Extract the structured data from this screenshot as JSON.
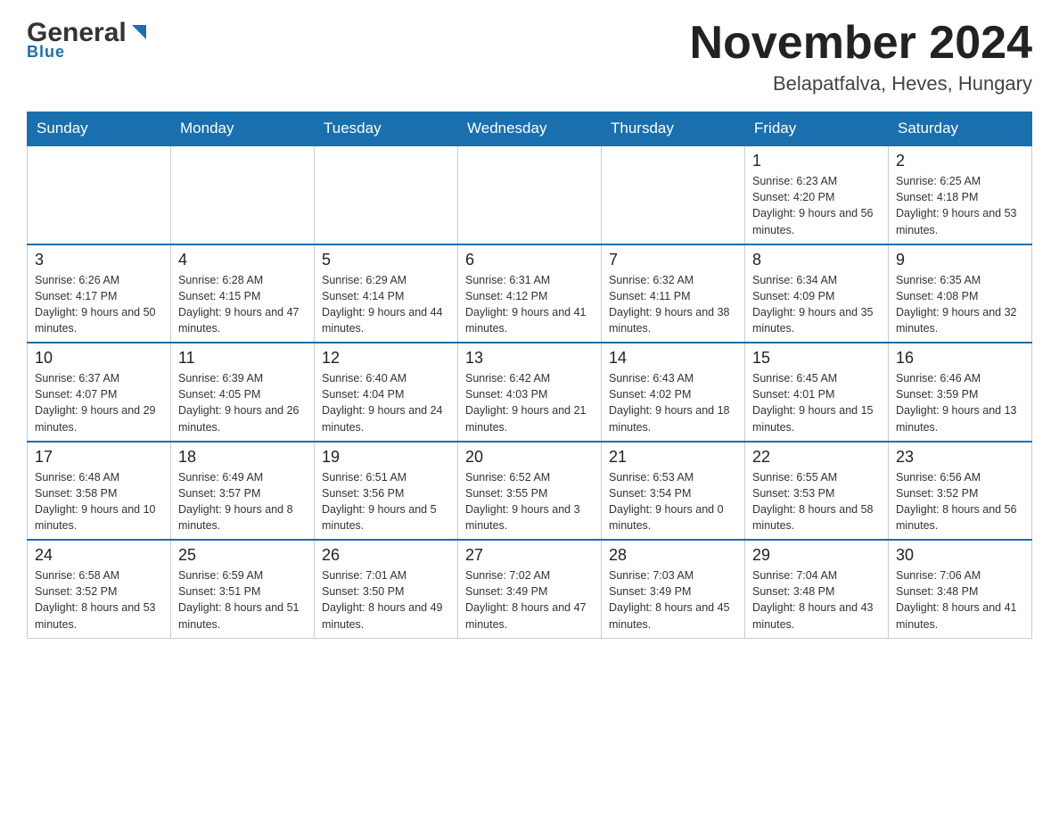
{
  "header": {
    "logo_general": "General",
    "logo_blue": "Blue",
    "month_title": "November 2024",
    "location": "Belapatfalva, Heves, Hungary"
  },
  "days_of_week": [
    "Sunday",
    "Monday",
    "Tuesday",
    "Wednesday",
    "Thursday",
    "Friday",
    "Saturday"
  ],
  "weeks": [
    {
      "days": [
        {
          "num": "",
          "info": ""
        },
        {
          "num": "",
          "info": ""
        },
        {
          "num": "",
          "info": ""
        },
        {
          "num": "",
          "info": ""
        },
        {
          "num": "",
          "info": ""
        },
        {
          "num": "1",
          "info": "Sunrise: 6:23 AM\nSunset: 4:20 PM\nDaylight: 9 hours and 56 minutes."
        },
        {
          "num": "2",
          "info": "Sunrise: 6:25 AM\nSunset: 4:18 PM\nDaylight: 9 hours and 53 minutes."
        }
      ]
    },
    {
      "days": [
        {
          "num": "3",
          "info": "Sunrise: 6:26 AM\nSunset: 4:17 PM\nDaylight: 9 hours and 50 minutes."
        },
        {
          "num": "4",
          "info": "Sunrise: 6:28 AM\nSunset: 4:15 PM\nDaylight: 9 hours and 47 minutes."
        },
        {
          "num": "5",
          "info": "Sunrise: 6:29 AM\nSunset: 4:14 PM\nDaylight: 9 hours and 44 minutes."
        },
        {
          "num": "6",
          "info": "Sunrise: 6:31 AM\nSunset: 4:12 PM\nDaylight: 9 hours and 41 minutes."
        },
        {
          "num": "7",
          "info": "Sunrise: 6:32 AM\nSunset: 4:11 PM\nDaylight: 9 hours and 38 minutes."
        },
        {
          "num": "8",
          "info": "Sunrise: 6:34 AM\nSunset: 4:09 PM\nDaylight: 9 hours and 35 minutes."
        },
        {
          "num": "9",
          "info": "Sunrise: 6:35 AM\nSunset: 4:08 PM\nDaylight: 9 hours and 32 minutes."
        }
      ]
    },
    {
      "days": [
        {
          "num": "10",
          "info": "Sunrise: 6:37 AM\nSunset: 4:07 PM\nDaylight: 9 hours and 29 minutes."
        },
        {
          "num": "11",
          "info": "Sunrise: 6:39 AM\nSunset: 4:05 PM\nDaylight: 9 hours and 26 minutes."
        },
        {
          "num": "12",
          "info": "Sunrise: 6:40 AM\nSunset: 4:04 PM\nDaylight: 9 hours and 24 minutes."
        },
        {
          "num": "13",
          "info": "Sunrise: 6:42 AM\nSunset: 4:03 PM\nDaylight: 9 hours and 21 minutes."
        },
        {
          "num": "14",
          "info": "Sunrise: 6:43 AM\nSunset: 4:02 PM\nDaylight: 9 hours and 18 minutes."
        },
        {
          "num": "15",
          "info": "Sunrise: 6:45 AM\nSunset: 4:01 PM\nDaylight: 9 hours and 15 minutes."
        },
        {
          "num": "16",
          "info": "Sunrise: 6:46 AM\nSunset: 3:59 PM\nDaylight: 9 hours and 13 minutes."
        }
      ]
    },
    {
      "days": [
        {
          "num": "17",
          "info": "Sunrise: 6:48 AM\nSunset: 3:58 PM\nDaylight: 9 hours and 10 minutes."
        },
        {
          "num": "18",
          "info": "Sunrise: 6:49 AM\nSunset: 3:57 PM\nDaylight: 9 hours and 8 minutes."
        },
        {
          "num": "19",
          "info": "Sunrise: 6:51 AM\nSunset: 3:56 PM\nDaylight: 9 hours and 5 minutes."
        },
        {
          "num": "20",
          "info": "Sunrise: 6:52 AM\nSunset: 3:55 PM\nDaylight: 9 hours and 3 minutes."
        },
        {
          "num": "21",
          "info": "Sunrise: 6:53 AM\nSunset: 3:54 PM\nDaylight: 9 hours and 0 minutes."
        },
        {
          "num": "22",
          "info": "Sunrise: 6:55 AM\nSunset: 3:53 PM\nDaylight: 8 hours and 58 minutes."
        },
        {
          "num": "23",
          "info": "Sunrise: 6:56 AM\nSunset: 3:52 PM\nDaylight: 8 hours and 56 minutes."
        }
      ]
    },
    {
      "days": [
        {
          "num": "24",
          "info": "Sunrise: 6:58 AM\nSunset: 3:52 PM\nDaylight: 8 hours and 53 minutes."
        },
        {
          "num": "25",
          "info": "Sunrise: 6:59 AM\nSunset: 3:51 PM\nDaylight: 8 hours and 51 minutes."
        },
        {
          "num": "26",
          "info": "Sunrise: 7:01 AM\nSunset: 3:50 PM\nDaylight: 8 hours and 49 minutes."
        },
        {
          "num": "27",
          "info": "Sunrise: 7:02 AM\nSunset: 3:49 PM\nDaylight: 8 hours and 47 minutes."
        },
        {
          "num": "28",
          "info": "Sunrise: 7:03 AM\nSunset: 3:49 PM\nDaylight: 8 hours and 45 minutes."
        },
        {
          "num": "29",
          "info": "Sunrise: 7:04 AM\nSunset: 3:48 PM\nDaylight: 8 hours and 43 minutes."
        },
        {
          "num": "30",
          "info": "Sunrise: 7:06 AM\nSunset: 3:48 PM\nDaylight: 8 hours and 41 minutes."
        }
      ]
    }
  ]
}
